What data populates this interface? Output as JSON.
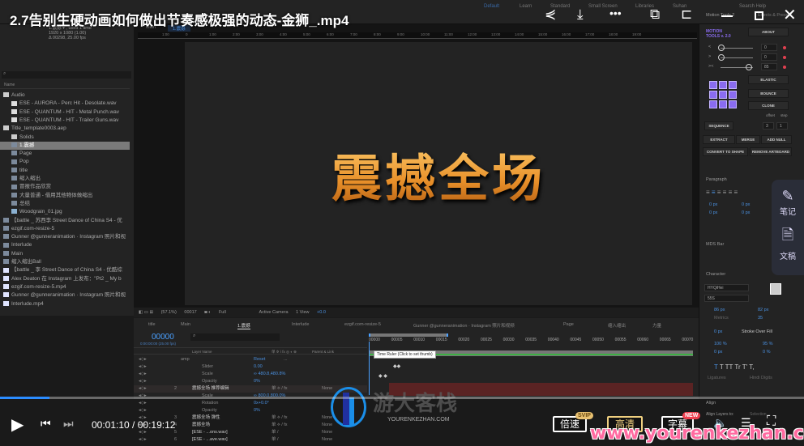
{
  "video": {
    "title": "2.7告别生硬动画如何做出节奏感极强的动态-金狮_.mp4",
    "current_time": "00:01:10",
    "duration": "00:19:12",
    "progress_percent": 6.1,
    "speed_label": "倍速",
    "speed_badge": "SVIP",
    "quality_label": "高清",
    "subtitle_label": "字幕",
    "subtitle_badge": "NEW",
    "accent": "#2b8cff"
  },
  "side_widget": {
    "items": [
      {
        "icon": "note-edit-icon",
        "label": "笔记"
      },
      {
        "icon": "document-ai-icon",
        "label": "文稿"
      }
    ]
  },
  "watermark": {
    "logo_text": "游大客栈",
    "logo_sub": "YOURENKEZHAN.COM",
    "url": "www.yourenkezhan.com"
  },
  "ae": {
    "workspaces": [
      "Default",
      "Learn",
      "Standard",
      "Small Screen",
      "Libraries",
      "Suhan"
    ],
    "search_help": "Search Help",
    "project": {
      "comp_name": "1.震撼 ▾ , used 1 time",
      "comp_size": "1920 x 1080 (1.00)",
      "comp_duration": "Δ 00298, 25.00 fps",
      "name_header": "Name",
      "items": [
        {
          "label": "Audio",
          "type": "folder",
          "indent": 0
        },
        {
          "label": "ESE - AURORA - Perc Hit - Desolate.wav",
          "type": "audio",
          "indent": 1
        },
        {
          "label": "ESE - QUANTUM - HIT - Metal Punch.wav",
          "type": "audio",
          "indent": 1
        },
        {
          "label": "ESE - QUANTUM - HIT - Trailer Guns.wav",
          "type": "audio",
          "indent": 1
        },
        {
          "label": "Title_template0003.aep",
          "type": "folder",
          "indent": 0
        },
        {
          "label": "Solids",
          "type": "folder",
          "indent": 1
        },
        {
          "label": "1.震撼",
          "type": "comp",
          "indent": 1,
          "selected": true
        },
        {
          "label": "Page",
          "type": "comp",
          "indent": 1
        },
        {
          "label": "Pop",
          "type": "comp",
          "indent": 1
        },
        {
          "label": "title",
          "type": "comp",
          "indent": 1
        },
        {
          "label": "缩入缩出",
          "type": "comp",
          "indent": 1
        },
        {
          "label": "冒报作品欣赏",
          "type": "comp",
          "indent": 1
        },
        {
          "label": "大量普通 - 借用其他物体做缩出",
          "type": "comp",
          "indent": 1
        },
        {
          "label": "总结",
          "type": "comp",
          "indent": 1
        },
        {
          "label": "Woodgrain_01.jpg",
          "type": "image",
          "indent": 1
        },
        {
          "label": "【battle _ 苏西李 Street Dance of China S4 - 优",
          "type": "comp",
          "indent": 0
        },
        {
          "label": "ezgif.com-resize-5",
          "type": "comp",
          "indent": 0
        },
        {
          "label": "Gunner @gunneranimation · Instagram 照片和视",
          "type": "comp",
          "indent": 0
        },
        {
          "label": "Interlude",
          "type": "comp",
          "indent": 0
        },
        {
          "label": "Main",
          "type": "comp",
          "indent": 0
        },
        {
          "label": "缩入缩出Ball",
          "type": "comp",
          "indent": 0
        },
        {
          "label": "【battle _ 李 Street Dance of China S4 - 优酷综",
          "type": "video",
          "indent": 0
        },
        {
          "label": "Alex Deaton 在 Instagram 上发布：\"Pt2 _ My b",
          "type": "video",
          "indent": 0
        },
        {
          "label": "ezgif.com-resize-5.mp4",
          "type": "video",
          "indent": 0
        },
        {
          "label": "Gunner @gunneranimation · Instagram 照片和视",
          "type": "video",
          "indent": 0
        },
        {
          "label": "Interlude.mp4",
          "type": "video",
          "indent": 0
        }
      ]
    },
    "viewer": {
      "breadcrumb": [
        "Main",
        "1.震撼"
      ],
      "ruler_ticks": [
        "1:00",
        "0",
        "1:00",
        "2:00",
        "3:00",
        "4:00",
        "5:00",
        "6:00",
        "7:00",
        "8:00",
        "9:00",
        "10:00",
        "11:00",
        "12:00",
        "13:00",
        "14:00",
        "15:00",
        "16:00",
        "17:00",
        "18:00",
        "19:00"
      ],
      "comp_text": "震撼全场",
      "text_color": "#f0a030",
      "zoom": "(57.1%)",
      "frame": "00017",
      "resolution": "Full",
      "camera": "Active Camera",
      "views": "1 View",
      "exposure": "+0.0"
    },
    "timeline": {
      "tabs": [
        "title",
        "Main",
        "1.震撼",
        "Interlude",
        "ezgif.com-resize-5",
        "Gunner @gunneranimation · Instagram 照片和视频",
        "Page",
        "缩入缩出",
        "力量"
      ],
      "active_tab": "1.震撼",
      "timecode": "00000",
      "timecode_sub": "0:00:00:00 (25.00 fps)",
      "headers": {
        "layer_name": "Layer Name",
        "switches": "单 ✲ \\ fx ◎ ◐ ⊕",
        "parent": "Parent & Link"
      },
      "tooltip": "Time Ruler (Click to set thumb)",
      "ticks": [
        "00000",
        "00005",
        "00010",
        "00015",
        "00020",
        "00025",
        "00030",
        "00035",
        "00040",
        "00045",
        "00050",
        "00055",
        "00060",
        "00065",
        "00070"
      ],
      "rows": [
        {
          "name": "amp",
          "value": "Reset",
          "extra": "..."
        },
        {
          "name": "Slider",
          "value": "0.00"
        },
        {
          "name": "Scale",
          "value": "∞ 480.8,480.8%"
        },
        {
          "name": "Opacity",
          "value": "0%"
        },
        {
          "num": "2",
          "name": "震撼全场 推荐编辑",
          "value": "单 ⟡ / fx",
          "parent": "None"
        },
        {
          "name": "Scale",
          "value": "∞ 800.0,800.0%"
        },
        {
          "name": "Rotation",
          "value": "0x+0.0°"
        },
        {
          "name": "Opacity",
          "value": "0%"
        },
        {
          "num": "3",
          "name": "震撼全场 弹性",
          "value": "单 ⟡ / fx",
          "parent": "None"
        },
        {
          "num": "4",
          "name": "震撼全场",
          "value": "单 ⟡ / fx",
          "parent": "None"
        },
        {
          "num": "5",
          "name": "[ESE - ...ons.wav]",
          "value": "单 /",
          "parent": "None"
        },
        {
          "num": "6",
          "name": "[ESE - ...ave.wav]",
          "value": "单 /",
          "parent": "None"
        }
      ]
    },
    "motion_tools": {
      "tab": "Motion Tools 2",
      "tab2": "Effects & Presets",
      "logo": "MOTION TOOLS v. 2.0",
      "about": "ABOUT",
      "sliders": [
        {
          "label": "<",
          "value": "0",
          "level": 0
        },
        {
          "label": ">",
          "value": "0",
          "level": 0
        },
        {
          "label": "><",
          "value": "85",
          "level": 0.85
        }
      ],
      "elastic": "ELASTIC",
      "bounce": "BOUNCE",
      "clone": "CLONE",
      "offset_label": "offset",
      "step_label": "step",
      "sequence": "SEQUENCE",
      "offset": "3",
      "step": "1",
      "extract": "EXTRACT",
      "merge": "MERGE",
      "add_null": "ADD NULL",
      "convert": "CONVERT TO SHAPE",
      "remove_artboard": "REMOVE ARTBOARD",
      "accent": "#8a6cf0"
    },
    "paragraph": {
      "title": "Paragraph",
      "indent_values": [
        "0 px",
        "0 px",
        "0 px",
        "0 px"
      ]
    },
    "mds_bar": {
      "title": "MDS Bar"
    },
    "character": {
      "title": "Character",
      "font": "HYQiHei",
      "style": "55S",
      "size": "86 px",
      "leading": "82 px",
      "kerning": "Metrics",
      "tracking": "35",
      "stroke": "0 px",
      "stroke_mode": "Stroke Over Fill",
      "vscale": "100 %",
      "hscale": "95 %",
      "baseline": "0 px",
      "tsume": "0 %",
      "styles": [
        "T",
        "T",
        "TT",
        "Tr",
        "T'",
        "T,"
      ],
      "ligatures": "Ligatures",
      "hindi": "Hindi Digits"
    },
    "align": {
      "title": "Align",
      "layers_to": "Align Layers to:",
      "selection": "Selection"
    }
  }
}
